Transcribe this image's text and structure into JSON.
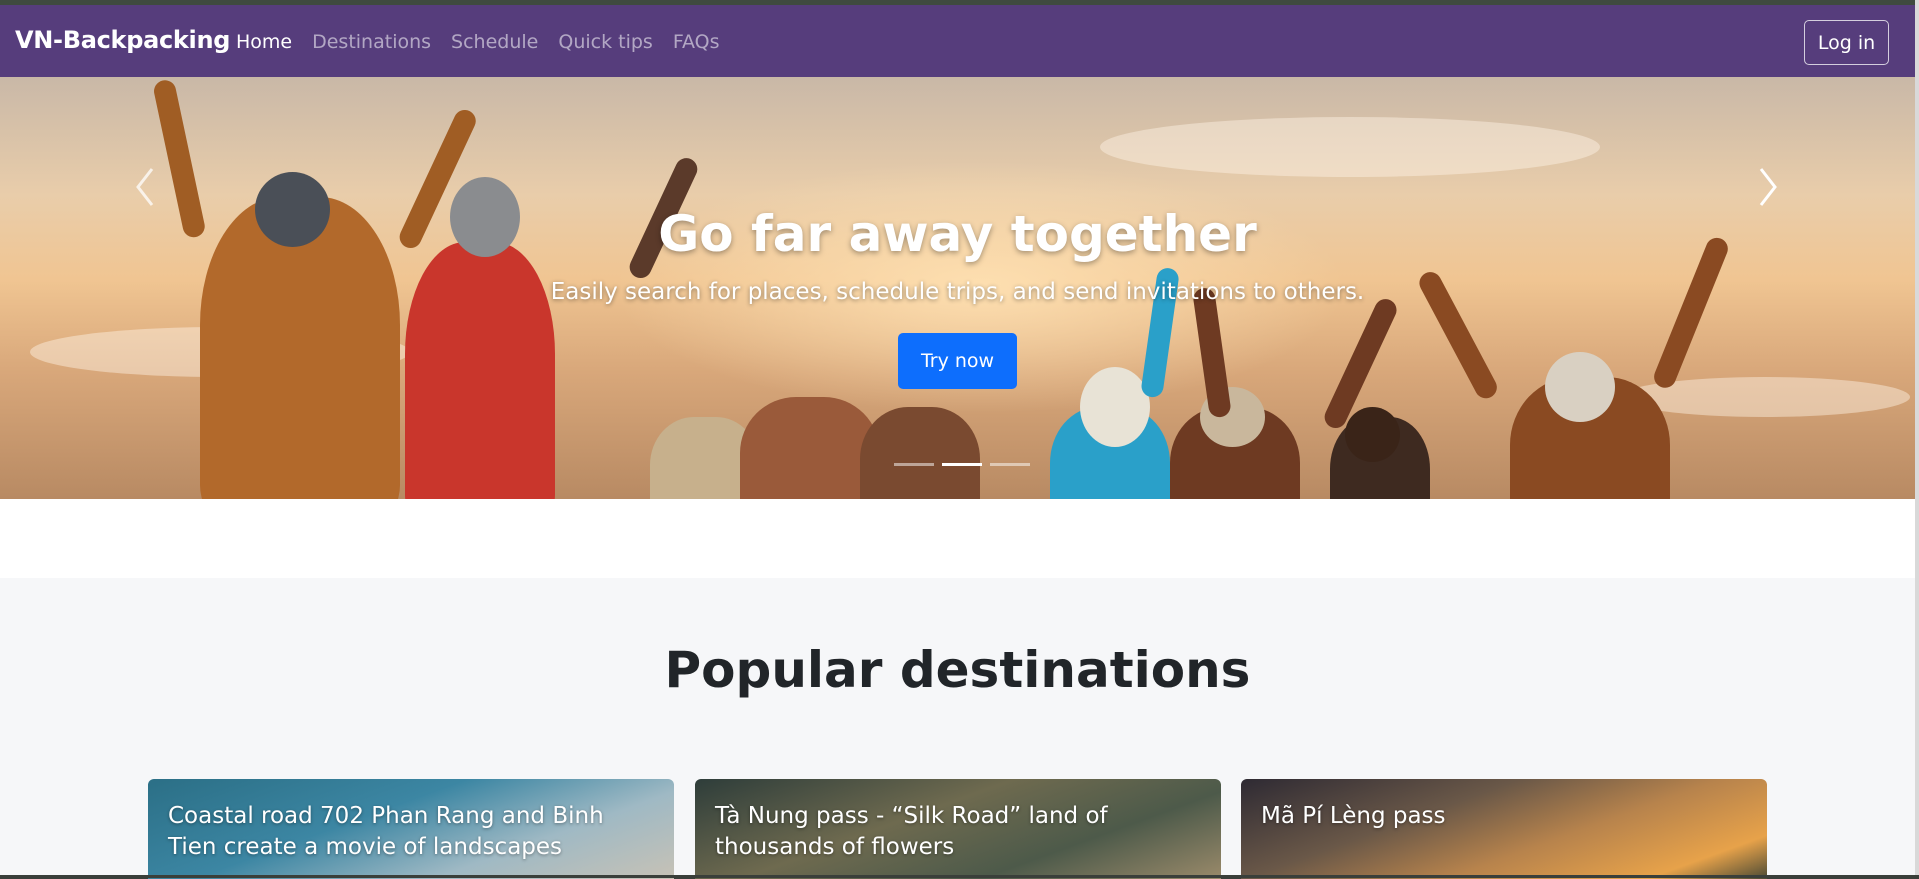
{
  "navbar": {
    "brand": "VN-Backpacking",
    "links": [
      {
        "label": "Home",
        "active": true
      },
      {
        "label": "Destinations",
        "active": false
      },
      {
        "label": "Schedule",
        "active": false
      },
      {
        "label": "Quick tips",
        "active": false
      },
      {
        "label": "FAQs",
        "active": false
      }
    ],
    "login_label": "Log in",
    "background_color": "#563d7c"
  },
  "hero": {
    "title": "Go far away together",
    "subtitle": "Easily search for places, schedule trips, and send invitations to others.",
    "cta_label": "Try now",
    "cta_color": "#0d6efd",
    "prev_icon": "chevron-left-icon",
    "next_icon": "chevron-right-icon",
    "slide_count": 3,
    "active_slide": 2
  },
  "popular": {
    "title": "Popular destinations",
    "cards": [
      {
        "title": "Coastal road 702 Phan Rang and Binh Tien create a movie of landscapes"
      },
      {
        "title": "Tà Nung pass - “Silk Road” land of thousands of flowers"
      },
      {
        "title": "Mã Pí Lèng pass"
      }
    ]
  }
}
